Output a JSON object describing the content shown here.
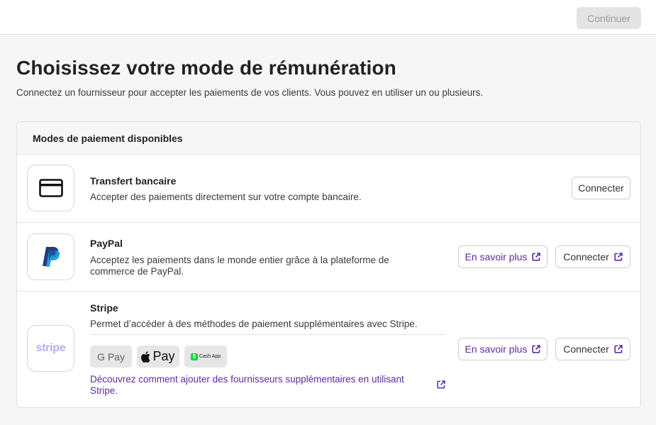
{
  "header": {
    "continue_label": "Continuer"
  },
  "page": {
    "title": "Choisissez votre mode de rémunération",
    "subtitle": "Connectez un fournisseur pour accepter les paiements de vos clients. Vous pouvez en utiliser un ou plusieurs."
  },
  "methods_card": {
    "title": "Modes de paiement disponibles",
    "items": [
      {
        "name": "Transfert bancaire",
        "description": "Accepter des paiements directement sur votre compte bancaire.",
        "connect_label": "Connecter",
        "icon": "credit-card-icon"
      },
      {
        "name": "PayPal",
        "description": "Acceptez les paiements dans le monde entier grâce à la plateforme de commerce de PayPal.",
        "learn_more_label": "En savoir plus",
        "connect_label": "Connecter",
        "icon": "paypal-logo"
      },
      {
        "name": "Stripe",
        "logo_text": "stripe",
        "description": "Permet d’accéder à des méthodes de paiement supplémentaires avec Stripe.",
        "wallets": [
          "G Pay",
          "Pay",
          "Cash App"
        ],
        "providers_link": "Découvrez comment ajouter des fournisseurs supplémentaires en utilisant Stripe.",
        "learn_more_label": "En savoir plus",
        "connect_label": "Connecter",
        "icon": "stripe-logo"
      }
    ]
  },
  "colors": {
    "accent": "#5a2ca0",
    "disabled_bg": "#e4e4e4",
    "stripe": "#b3acf8",
    "paypal_dark": "#253b80",
    "paypal_light": "#179bd7",
    "cash_app": "#00d632"
  }
}
